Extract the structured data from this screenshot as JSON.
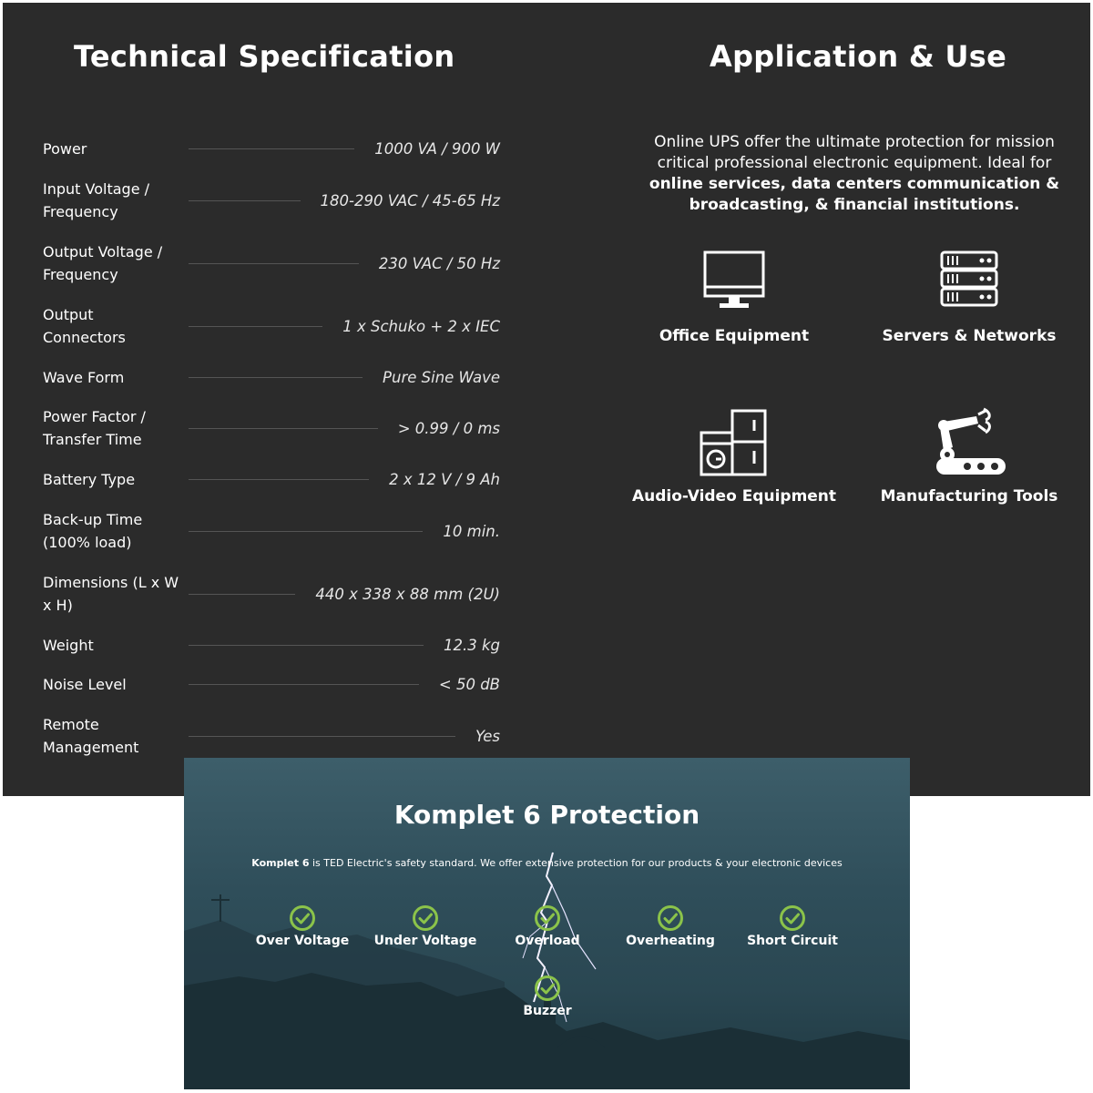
{
  "spec": {
    "title": "Technical Specification",
    "rows": [
      {
        "label": "Power",
        "value": "1000 VA / 900 W"
      },
      {
        "label": "Input Voltage / Frequency",
        "value": "180-290 VAC / 45-65 Hz"
      },
      {
        "label": "Output Voltage / Frequency",
        "value": "230 VAC / 50 Hz"
      },
      {
        "label": "Output Connectors",
        "value": "1 x Schuko + 2 x IEC"
      },
      {
        "label": "Wave Form",
        "value": "Pure Sine Wave"
      },
      {
        "label": "Power Factor / Transfer Time",
        "value": "> 0.99 / 0 ms"
      },
      {
        "label": "Battery Type",
        "value": "2 x 12 V / 9 Ah"
      },
      {
        "label": "Back-up Time (100% load)",
        "value": "10 min."
      },
      {
        "label": "Dimensions (L x W x H)",
        "value": "440 x 338 x 88 mm (2U)"
      },
      {
        "label": "Weight",
        "value": "12.3 kg"
      },
      {
        "label": "Noise Level",
        "value": "< 50 dB"
      },
      {
        "label": "Remote Management",
        "value": "Yes"
      }
    ]
  },
  "application": {
    "title": "Application & Use",
    "desc_plain_1": "Online UPS offer the ultimate protection for mission critical professional electronic equipment.  Ideal for ",
    "desc_bold": "online services, data centers communication & broadcasting, & financial institutions.",
    "items": [
      {
        "label": "Office Equipment",
        "icon": "monitor-icon"
      },
      {
        "label": "Servers & Networks",
        "icon": "server-rack-icon"
      },
      {
        "label": "Audio-Video Equipment",
        "icon": "appliances-icon"
      },
      {
        "label": "Manufacturing Tools",
        "icon": "robot-arm-icon"
      }
    ]
  },
  "protection": {
    "title_plain": "Komplet 6 ",
    "title_bold": "Protection",
    "desc_bold": "Komplet 6",
    "desc_plain": " is TED Electric's safety standard. We offer extensive protection for our products & your electronic devices",
    "items": [
      {
        "label": "Over Voltage",
        "icon": "check-circle-icon"
      },
      {
        "label": "Under Voltage",
        "icon": "check-circle-icon"
      },
      {
        "label": "Overload",
        "icon": "check-circle-icon"
      },
      {
        "label": "Overheating",
        "icon": "check-circle-icon"
      },
      {
        "label": "Short Circuit",
        "icon": "check-circle-icon"
      },
      {
        "label": "Buzzer",
        "icon": "check-circle-icon"
      }
    ],
    "accent_color": "#8bc34a"
  },
  "colors": {
    "panel_background": "#2b2b2b",
    "text": "#ffffff",
    "divider": "#555555"
  }
}
